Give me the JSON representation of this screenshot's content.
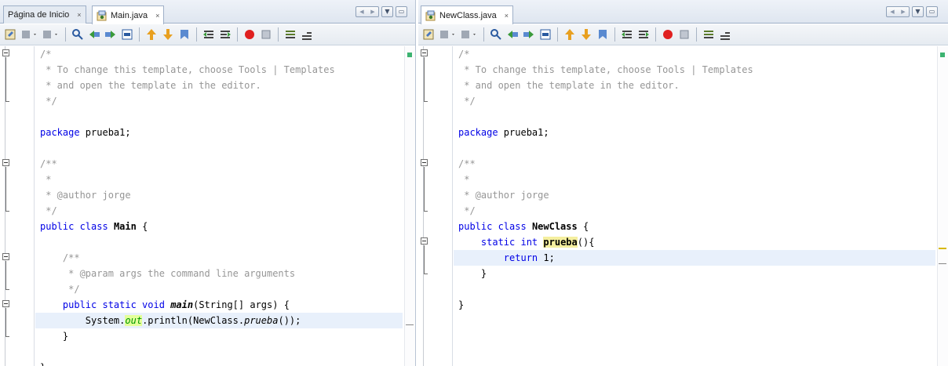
{
  "left_pane": {
    "tabs": [
      {
        "label": "Página de Inicio",
        "close": "×"
      },
      {
        "label": "Main.java",
        "close": "×"
      }
    ],
    "lines": [
      {
        "parts": [
          {
            "t": "/*",
            "c": "cm"
          }
        ]
      },
      {
        "parts": [
          {
            "t": " * To change this template, choose Tools | Templates",
            "c": "cm"
          }
        ]
      },
      {
        "parts": [
          {
            "t": " * and open the template in the editor.",
            "c": "cm"
          }
        ]
      },
      {
        "parts": [
          {
            "t": " */",
            "c": "cm"
          }
        ]
      },
      {
        "parts": []
      },
      {
        "parts": [
          {
            "t": "package",
            "c": "kw"
          },
          {
            "t": " prueba1;",
            "c": ""
          }
        ]
      },
      {
        "parts": []
      },
      {
        "parts": [
          {
            "t": "/**",
            "c": "cm"
          }
        ]
      },
      {
        "parts": [
          {
            "t": " *",
            "c": "cm"
          }
        ]
      },
      {
        "parts": [
          {
            "t": " * @author jorge",
            "c": "cm"
          }
        ]
      },
      {
        "parts": [
          {
            "t": " */",
            "c": "cm"
          }
        ]
      },
      {
        "parts": [
          {
            "t": "public class",
            "c": "kw"
          },
          {
            "t": " ",
            "c": ""
          },
          {
            "t": "Main",
            "c": "b"
          },
          {
            "t": " {",
            "c": ""
          }
        ]
      },
      {
        "parts": []
      },
      {
        "parts": [
          {
            "t": "    /**",
            "c": "cm"
          }
        ]
      },
      {
        "parts": [
          {
            "t": "     * @param args the command line arguments",
            "c": "cm"
          }
        ]
      },
      {
        "parts": [
          {
            "t": "     */",
            "c": "cm"
          }
        ]
      },
      {
        "parts": [
          {
            "t": "    ",
            "c": ""
          },
          {
            "t": "public static void",
            "c": "kw"
          },
          {
            "t": " ",
            "c": ""
          },
          {
            "t": "main",
            "c": "b it"
          },
          {
            "t": "(String[] args) {",
            "c": ""
          }
        ]
      },
      {
        "parts": [
          {
            "t": "        System.",
            "c": ""
          },
          {
            "t": "out",
            "c": "fld"
          },
          {
            "t": ".println(NewClass.",
            "c": ""
          },
          {
            "t": "prueba",
            "c": "it"
          },
          {
            "t": "());",
            "c": ""
          }
        ],
        "current": true
      },
      {
        "parts": [
          {
            "t": "    }",
            "c": ""
          }
        ]
      },
      {
        "parts": []
      },
      {
        "parts": [
          {
            "t": "}",
            "c": ""
          }
        ]
      }
    ]
  },
  "right_pane": {
    "tabs": [
      {
        "label": "NewClass.java",
        "close": "×"
      }
    ],
    "lines": [
      {
        "parts": [
          {
            "t": "/*",
            "c": "cm"
          }
        ]
      },
      {
        "parts": [
          {
            "t": " * To change this template, choose Tools | Templates",
            "c": "cm"
          }
        ]
      },
      {
        "parts": [
          {
            "t": " * and open the template in the editor.",
            "c": "cm"
          }
        ]
      },
      {
        "parts": [
          {
            "t": " */",
            "c": "cm"
          }
        ]
      },
      {
        "parts": []
      },
      {
        "parts": [
          {
            "t": "package",
            "c": "kw"
          },
          {
            "t": " prueba1;",
            "c": ""
          }
        ]
      },
      {
        "parts": []
      },
      {
        "parts": [
          {
            "t": "/**",
            "c": "cm"
          }
        ]
      },
      {
        "parts": [
          {
            "t": " *",
            "c": "cm"
          }
        ]
      },
      {
        "parts": [
          {
            "t": " * @author jorge",
            "c": "cm"
          }
        ]
      },
      {
        "parts": [
          {
            "t": " */",
            "c": "cm"
          }
        ]
      },
      {
        "parts": [
          {
            "t": "public class",
            "c": "kw"
          },
          {
            "t": " ",
            "c": ""
          },
          {
            "t": "NewClass",
            "c": "b"
          },
          {
            "t": " {",
            "c": ""
          }
        ]
      },
      {
        "parts": [
          {
            "t": "    ",
            "c": ""
          },
          {
            "t": "static int",
            "c": "kw"
          },
          {
            "t": " ",
            "c": ""
          },
          {
            "t": "prueba",
            "c": "occ"
          },
          {
            "t": "(){",
            "c": ""
          }
        ]
      },
      {
        "parts": [
          {
            "t": "        ",
            "c": ""
          },
          {
            "t": "return",
            "c": "kw"
          },
          {
            "t": " 1;",
            "c": ""
          }
        ],
        "current": true
      },
      {
        "parts": [
          {
            "t": "    }",
            "c": ""
          }
        ]
      },
      {
        "parts": []
      },
      {
        "parts": [
          {
            "t": "}",
            "c": ""
          }
        ]
      }
    ]
  },
  "toolbar_icons": [
    "last-edit-icon",
    "back-icon",
    "forward-icon",
    "find-selection-icon",
    "find-previous-icon",
    "find-next-icon",
    "toggle-highlight-icon",
    "previous-bookmark-icon",
    "next-bookmark-icon",
    "toggle-bookmark-icon",
    "shift-left-icon",
    "shift-right-icon",
    "start-macro-icon",
    "stop-macro-icon",
    "comment-icon",
    "uncomment-icon"
  ],
  "colors": {
    "keyword": "#0000e6",
    "comment": "#969696",
    "current_line": "#e8f0fb",
    "field": "#009900",
    "occurrence": "#f5ef9f"
  }
}
